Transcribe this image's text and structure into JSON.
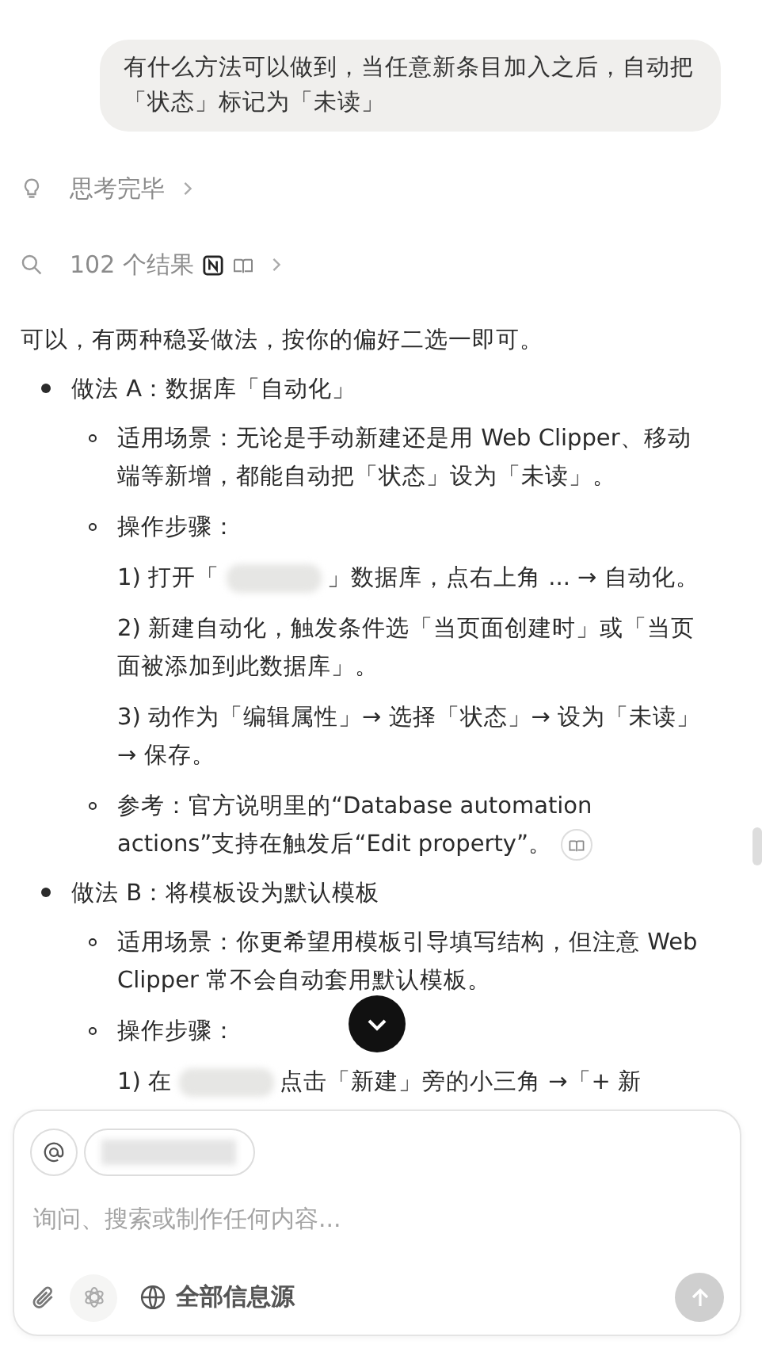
{
  "user_message": "有什么方法可以做到，当任意新条目加入之后，自动把「状态」标记为「未读」",
  "thinking": {
    "label": "思考完毕"
  },
  "search_results": {
    "label": "102 个结果"
  },
  "answer": {
    "intro": "可以，有两种稳妥做法，按你的偏好二选一即可。",
    "sections": [
      {
        "title": "做法 A：数据库「自动化」",
        "items": [
          {
            "kind": "text",
            "text": "适用场景：无论是手动新建还是用 Web Clipper、移动端等新增，都能自动把「状态」设为「未读」。",
            "citation": false
          },
          {
            "kind": "steps",
            "label": "操作步骤：",
            "steps": [
              {
                "kind": "redacted",
                "before": "1) 打开「",
                "after": "」数据库，点右上角 ... → 自动化。"
              },
              {
                "kind": "plain",
                "text": "2) 新建自动化，触发条件选「当页面创建时」或「当页面被添加到此数据库」。"
              },
              {
                "kind": "plain",
                "text": "3) 动作为「编辑属性」→ 选择「状态」→ 设为「未读」→ 保存。"
              }
            ]
          },
          {
            "kind": "text",
            "text": "参考：官方说明里的“Database automation actions”支持在触发后“Edit property”。",
            "citation": true
          }
        ]
      },
      {
        "title": "做法 B：将模板设为默认模板",
        "items": [
          {
            "kind": "text",
            "text": "适用场景：你更希望用模板引导填写结构，但注意 Web Clipper 常不会自动套用默认模板。",
            "citation": false
          },
          {
            "kind": "steps",
            "label": "操作步骤：",
            "steps": [
              {
                "kind": "redacted",
                "before": "1) 在",
                "after": "点击「新建」旁的小三角 →「+ 新"
              }
            ]
          }
        ]
      }
    ]
  },
  "composer": {
    "placeholder": "询问、搜索或制作任何内容...",
    "source_label": "全部信息源"
  }
}
